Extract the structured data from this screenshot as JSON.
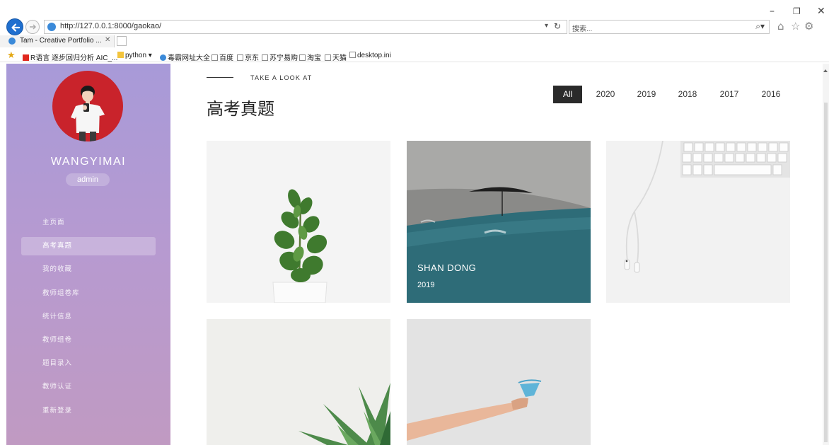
{
  "browser": {
    "address_url": "http://127.0.0.1:8000/gaokao/",
    "search_placeholder": "搜索...",
    "tab_title": "Tam - Creative Portfolio ...",
    "bookmarks": [
      "R语言 逐步回归分析 AIC_...",
      "python ▾",
      "毒霸网址大全",
      "百度",
      "京东",
      "苏宁易购",
      "淘宝",
      "天猫",
      "desktop.ini"
    ]
  },
  "sidebar": {
    "username": "WANGYIMAI",
    "role": "admin",
    "items": [
      {
        "label": "主页面",
        "active": false
      },
      {
        "label": "高考真题",
        "active": true
      },
      {
        "label": "我的收藏",
        "active": false
      },
      {
        "label": "教师组卷库",
        "active": false
      },
      {
        "label": "统计信息",
        "active": false
      },
      {
        "label": "教师组卷",
        "active": false
      },
      {
        "label": "题目录入",
        "active": false
      },
      {
        "label": "教师认证",
        "active": false
      },
      {
        "label": "重新登录",
        "active": false
      }
    ]
  },
  "header": {
    "eyebrow": "TAKE A LOOK AT",
    "title": "高考真题"
  },
  "filters": {
    "tabs": [
      {
        "label": "All",
        "active": true
      },
      {
        "label": "2020",
        "active": false
      },
      {
        "label": "2019",
        "active": false
      },
      {
        "label": "2018",
        "active": false
      },
      {
        "label": "2017",
        "active": false
      },
      {
        "label": "2016",
        "active": false
      }
    ]
  },
  "cards": [
    {
      "image": "plant-in-pot"
    },
    {
      "image": "umbrella-and-sea",
      "title": "SHAN DONG",
      "year": "2019"
    },
    {
      "image": "keyboard-and-earphones"
    },
    {
      "image": "succulent"
    },
    {
      "image": "hand-with-cup"
    }
  ],
  "colors": {
    "sidebar_top": "#a89ad8",
    "sidebar_bottom": "#c09ac2",
    "active_filter": "#2a2a2a",
    "avatar_bg": "#c9232b",
    "card2_teal": "#2e6c78"
  }
}
